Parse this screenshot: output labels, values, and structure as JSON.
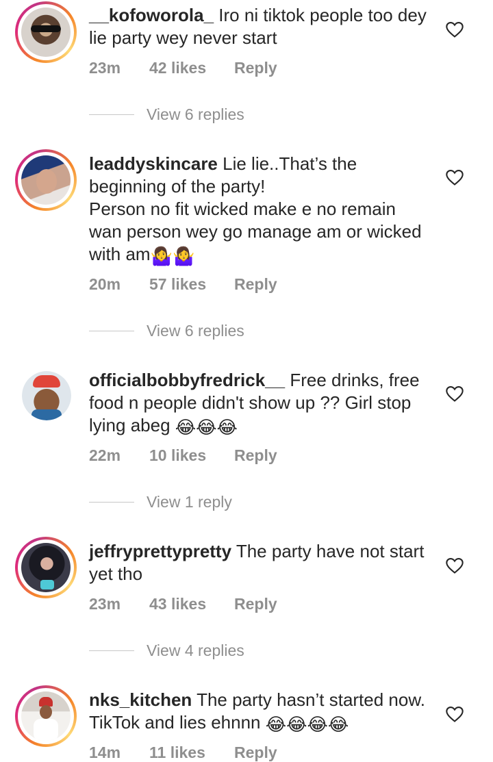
{
  "comments": [
    {
      "username": "__kofoworola_",
      "text": "Iro ni tiktok people too dey lie party wey never start",
      "time": "23m",
      "likes": "42 likes",
      "reply": "Reply",
      "view_replies": "View 6 replies"
    },
    {
      "username": "leaddyskincare",
      "text_line1": "Lie lie..That’s the beginning of the party!",
      "text_line2": "Person no fit wicked make e no remain wan person wey go manage am or wicked with am",
      "emoji": "🤷‍♀️🤷‍♀️",
      "time": "20m",
      "likes": "57 likes",
      "reply": "Reply",
      "view_replies": "View 6 replies"
    },
    {
      "username": "officialbobbyfredrick__",
      "text": "Free drinks, free food n people didn't show up ?? Girl stop lying abeg",
      "emoji": "😂😂😂",
      "time": "22m",
      "likes": "10 likes",
      "reply": "Reply",
      "view_replies": "View 1 reply"
    },
    {
      "username": "jeffryprettypretty",
      "text": "The party have not start yet tho",
      "time": "23m",
      "likes": "43 likes",
      "reply": "Reply",
      "view_replies": "View 4 replies"
    },
    {
      "username": "nks_kitchen",
      "text": "The party hasn’t started now. TikTok and lies ehnnn",
      "emoji": "😂😂😂😂",
      "time": "14m",
      "likes": "11 likes",
      "reply": "Reply"
    }
  ],
  "icons": {
    "like": "heart-outline-icon"
  },
  "colors": {
    "muted": "#8e8e8e",
    "text": "#262626",
    "ring": "#dd2a7b"
  }
}
